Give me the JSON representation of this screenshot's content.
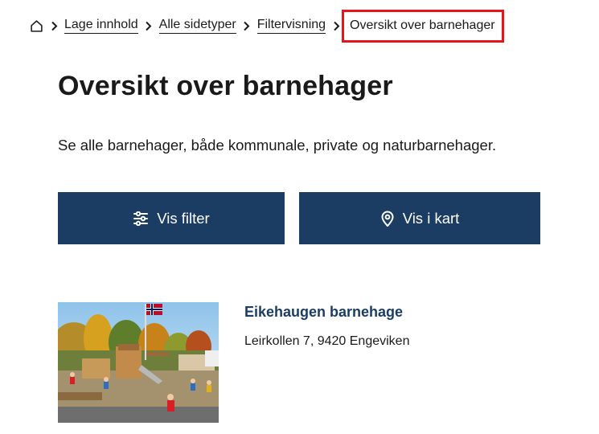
{
  "breadcrumb": {
    "home_icon": "home-icon",
    "separator_icon": "chevron-right-icon",
    "items": [
      {
        "label": "Lage innhold"
      },
      {
        "label": "Alle sidetyper"
      },
      {
        "label": "Filtervisning"
      }
    ],
    "current": "Oversikt over barnehager"
  },
  "page": {
    "title": "Oversikt over barnehager",
    "lead": "Se alle barnehager, både kommunale, private og naturbarnehager."
  },
  "actions": {
    "filter": {
      "label": "Vis filter",
      "icon": "sliders-icon"
    },
    "map": {
      "label": "Vis i kart",
      "icon": "map-pin-icon"
    }
  },
  "results": [
    {
      "name": "Eikehaugen barnehage",
      "address": "Leirkollen 7, 9420 Engeviken"
    }
  ],
  "colors": {
    "primary": "#1b3d64",
    "highlight": "#e8141c",
    "text": "#1a1a1a"
  }
}
